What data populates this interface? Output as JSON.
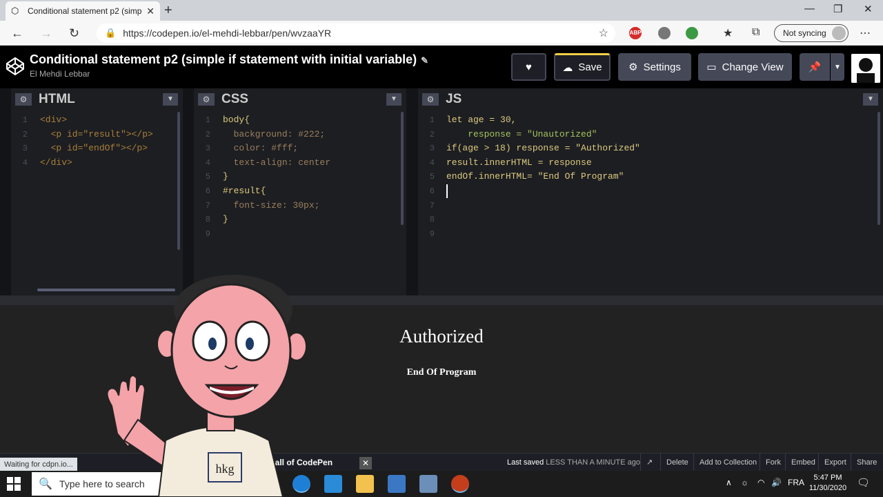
{
  "browser": {
    "tab_title": "Conditional statement p2 (simple",
    "url": "https://codepen.io/el-mehdi-lebbar/pen/wvzaaYR",
    "sync_label": "Not syncing",
    "abp_label": "ABP",
    "status_text": "Waiting for cdpn.io..."
  },
  "codepen": {
    "pen_title": "Conditional statement p2 (simple if statement with initial variable)",
    "author": "El Mehdi Lebbar",
    "save_label": "Save",
    "settings_label": "Settings",
    "change_view_label": "Change View"
  },
  "editors": {
    "html": {
      "name": "HTML",
      "line_numbers": [
        "1",
        "2",
        "3",
        "4"
      ],
      "lines": [
        "<div>",
        "  <p id=\"result\"></p>",
        "  <p id=\"endOf\"></p>",
        "</div>"
      ]
    },
    "css": {
      "name": "CSS",
      "line_numbers": [
        "1",
        "2",
        "3",
        "4",
        "5",
        "6",
        "7",
        "8",
        "9"
      ],
      "lines": [
        "body{",
        "  background: #222;",
        "  color: #fff;",
        "  text-align: center",
        "}",
        "",
        "#result{",
        "  font-size: 30px;",
        "}"
      ]
    },
    "js": {
      "name": "JS",
      "line_numbers": [
        "1",
        "2",
        "3",
        "4",
        "5",
        "6",
        "7",
        "8",
        "9"
      ],
      "lines": [
        "let age = 30,",
        "    response = \"Unautorized\"",
        "",
        "if(age > 18) response = \"Authorized\"",
        "",
        "result.innerHTML = response",
        "",
        "endOf.innerHTML= \"End Of Program\"",
        ""
      ]
    }
  },
  "preview": {
    "result_text": "Authorized",
    "endof_text": "End Of Program"
  },
  "footer": {
    "console_snippet": "kall of CodePen",
    "last_saved_prefix": "Last saved",
    "last_saved_value": "LESS THAN A MINUTE ago",
    "buttons": [
      "Delete",
      "Add to Collection",
      "Fork",
      "Embed",
      "Export",
      "Share"
    ]
  },
  "cartoon": {
    "shirt_text": "hkg"
  },
  "taskbar": {
    "search_placeholder": "Type here to search",
    "language": "FRA",
    "time": "5:47 PM",
    "date": "11/30/2020"
  },
  "colors": {
    "codepen_header": "#000000",
    "editor_bg": "#1d1e22",
    "preview_bg": "#222222",
    "save_accent": "#f7d046"
  }
}
